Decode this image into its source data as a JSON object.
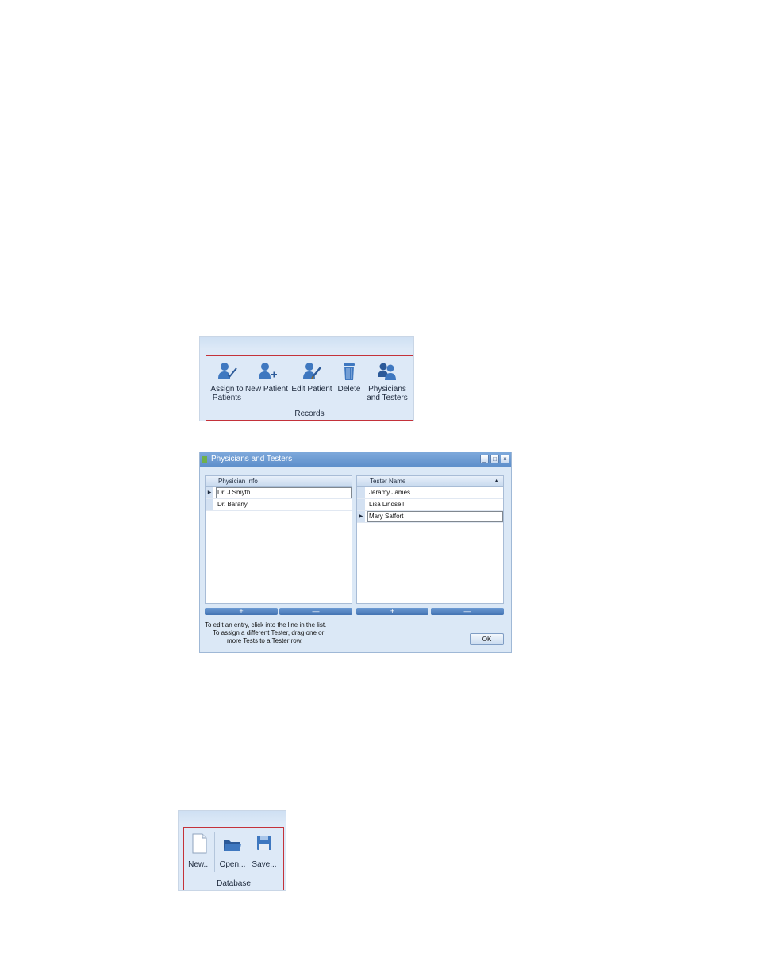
{
  "records_group": {
    "label": "Records",
    "buttons": [
      {
        "label": "Assign to\nPatients",
        "icon": "assign-patient-icon"
      },
      {
        "label": "New Patient",
        "icon": "new-patient-icon"
      },
      {
        "label": "Edit Patient",
        "icon": "edit-patient-icon"
      },
      {
        "label": "Delete",
        "icon": "trash-icon"
      },
      {
        "label": "Physicians\nand Testers",
        "icon": "users-group-icon"
      }
    ]
  },
  "dialog": {
    "title": "Physicians and Testers",
    "physicians": {
      "header": "Physician Info",
      "rows": [
        "Dr. J Smyth",
        "Dr. Barany"
      ]
    },
    "testers": {
      "header": "Tester Name",
      "rows": [
        "Jeramy James",
        "Lisa Lindsell",
        "Mary Saffort"
      ]
    },
    "add_symbol": "+",
    "remove_symbol": "—",
    "help_line1": "To edit an entry, click into the line in the list.",
    "help_line2": "To assign a different Tester, drag one or",
    "help_line3": "more Tests to a Tester row.",
    "ok_label": "OK"
  },
  "database_group": {
    "label": "Database",
    "buttons": [
      {
        "label": "New...",
        "icon": "new-document-icon"
      },
      {
        "label": "Open...",
        "icon": "folder-open-icon"
      },
      {
        "label": "Save...",
        "icon": "floppy-save-icon"
      }
    ]
  },
  "colors": {
    "ribbon_bg": "#dde9f7",
    "highlight_frame": "#c4323a",
    "title_bar": "#6a98d2",
    "icon_blue": "#3f78c0"
  }
}
